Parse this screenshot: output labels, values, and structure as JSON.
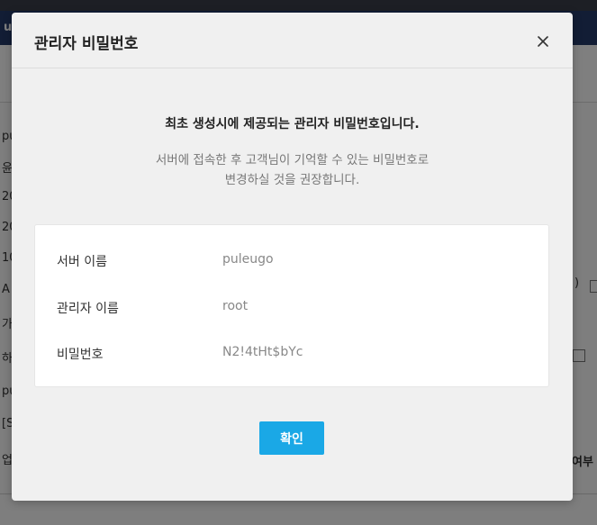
{
  "background": {
    "nav_text": "u",
    "left_fragments": [
      "pu",
      "윤",
      "20",
      "20",
      "10",
      "A",
      "가",
      "하",
      "pu",
      "[S",
      "업"
    ],
    "right_fragments": [
      ")",
      "여부"
    ]
  },
  "modal": {
    "title": "관리자 비밀번호",
    "close_icon": "close-icon",
    "headline": "최초 생성시에 제공되는 관리자 비밀번호입니다.",
    "description_line1": "서버에 접속한 후 고객님이 기억할 수 있는 비밀번호로",
    "description_line2": "변경하실 것을 권장합니다.",
    "info": [
      {
        "label": "서버 이름",
        "value": "puleugo"
      },
      {
        "label": "관리자 이름",
        "value": "root"
      },
      {
        "label": "비밀번호",
        "value": "N2!4tHt$bYc"
      }
    ],
    "confirm_label": "확인"
  },
  "colors": {
    "accent": "#1aa8e6",
    "modal_bg": "#f0f0f0",
    "navbar": "#243a6b"
  }
}
